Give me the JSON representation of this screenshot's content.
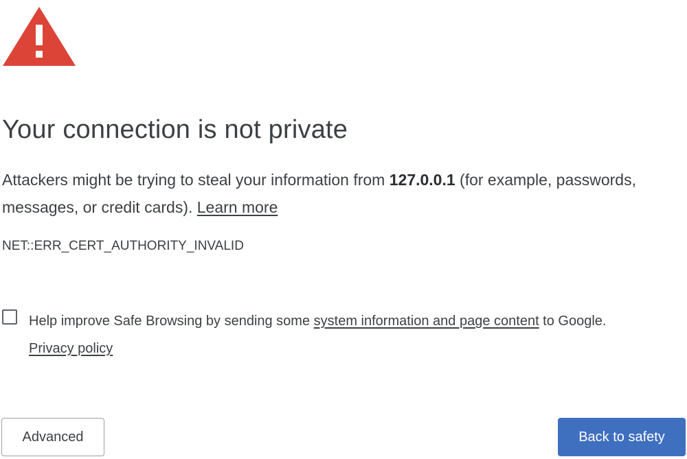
{
  "colors": {
    "warning_icon": "#db4437",
    "primary_button": "#3f6fbf",
    "text": "#3c4043"
  },
  "icon": "warning-triangle-icon",
  "interstitial": {
    "title": "Your connection is not private",
    "description": {
      "part1": "Attackers might be trying to steal your information from ",
      "host": "127.0.0.1",
      "part2": " (for example, passwords, messages, or credit cards). ",
      "learn_more": "Learn more"
    },
    "error_code": "NET::ERR_CERT_AUTHORITY_INVALID"
  },
  "optin": {
    "checked": false,
    "text_before": "Help improve Safe Browsing by sending some ",
    "link_text": "system information and page content",
    "text_after": " to Google.",
    "privacy_link": "Privacy policy"
  },
  "buttons": {
    "advanced": "Advanced",
    "back_to_safety": "Back to safety"
  }
}
